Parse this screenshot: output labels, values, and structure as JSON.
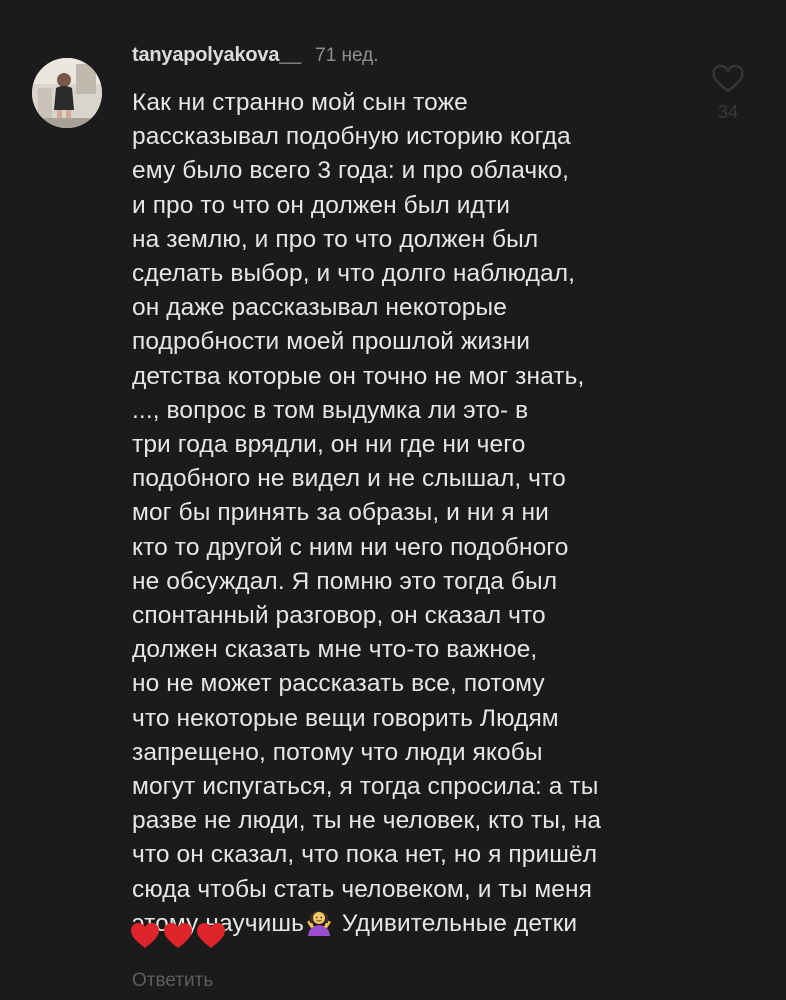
{
  "comment": {
    "username": "tanyapolyakova__",
    "time": "71 нед.",
    "lines": [
      "Как ни странно мой сын тоже",
      "рассказывал подобную историю когда",
      "ему было всего 3 года: и про облачко,",
      "и про то что он должен был идти",
      "на землю, и про то что должен был",
      "сделать выбор, и что долго наблюдал,",
      "он даже рассказывал некоторые",
      "подробности моей прошлой жизни",
      "детства которые он точно не мог знать,",
      "..., вопрос в том выдумка ли это- в",
      "три года врядли, он ни где ни чего",
      "подобного не видел и не слышал, что",
      "мог бы принять за образы, и ни я ни",
      "кто то другой с ним ни чего подобного",
      "не обсуждал. Я помню это тогда был",
      "спонтанный разговор, он сказал что",
      "должен сказать мне что-то важное,",
      "но не может рассказать все, потому",
      "что некоторые вещи говорить Людям",
      "запрещено, потому что люди якобы",
      "могут испугаться, я тогда спросила: а ты",
      "разве не люди, ты не человек, кто ты, на",
      "что он сказал, что пока нет, но я пришёл",
      "сюда чтобы стать человеком, и ты меня"
    ],
    "last_line_before_emoji": "этому научишь",
    "last_line_after_emoji": " Удивительные детки",
    "emoji_icon": "person-shrugging-emoji",
    "hearts_icon": "red-heart-emoji",
    "heart_color": "#e0242b",
    "reply_label": "Ответить",
    "like_count": "34"
  }
}
